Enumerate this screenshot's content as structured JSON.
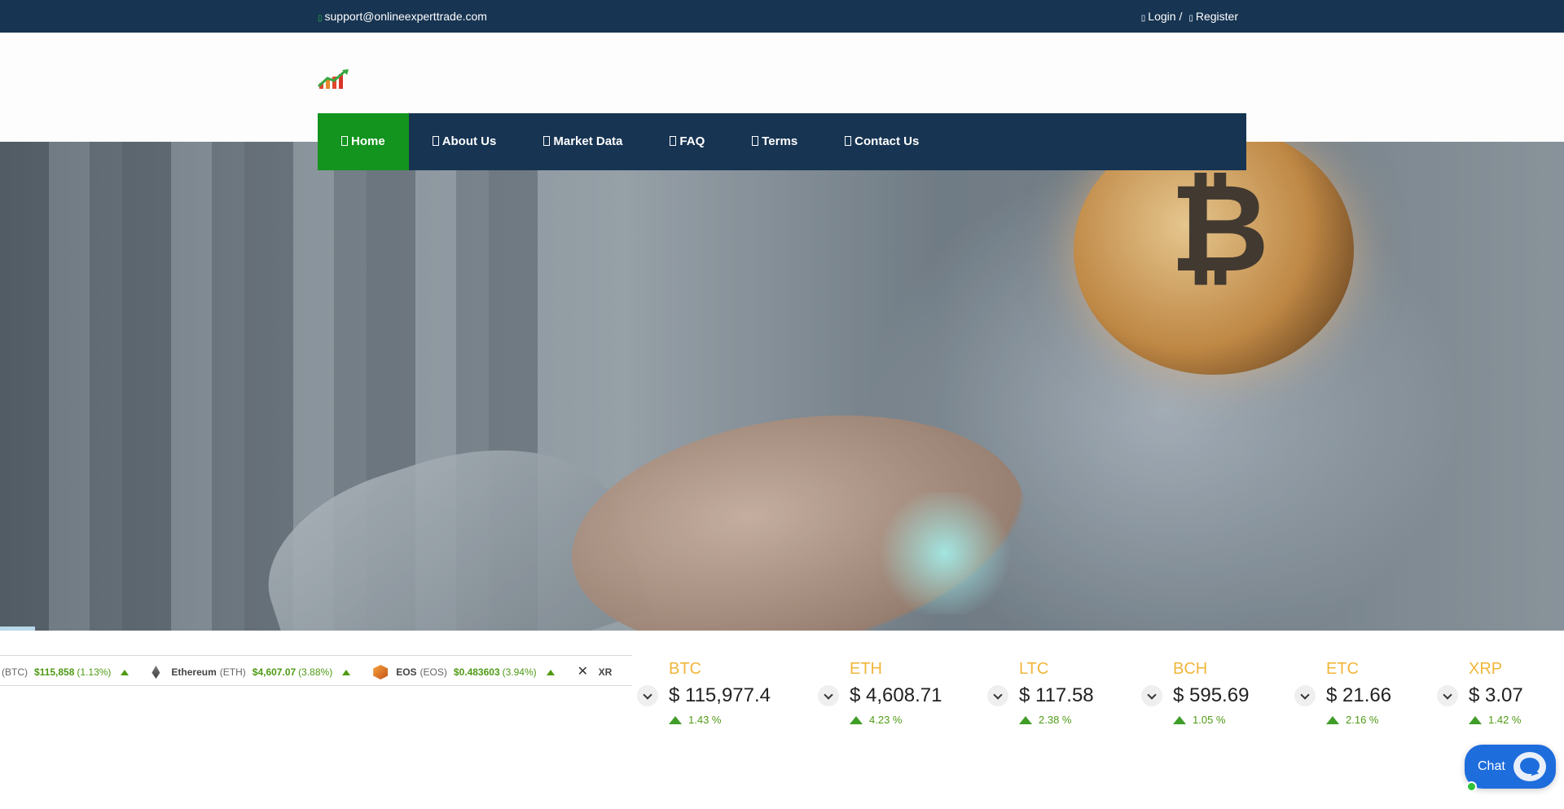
{
  "topbar": {
    "email": "support@onlineexperttrade.com",
    "login": "Login /",
    "register": "Register"
  },
  "nav": {
    "items": [
      {
        "label": "Home",
        "active": true
      },
      {
        "label": "About Us"
      },
      {
        "label": "Market Data"
      },
      {
        "label": "FAQ"
      },
      {
        "label": "Terms"
      },
      {
        "label": "Contact Us"
      }
    ]
  },
  "ticker": {
    "items": [
      {
        "name": "",
        "symbol": "(BTC)",
        "price": "$115,858",
        "change": "(1.13%)"
      },
      {
        "name": "Ethereum",
        "symbol": "(ETH)",
        "price": "$4,607.07",
        "change": "(3.88%)"
      },
      {
        "name": "EOS",
        "symbol": "(EOS)",
        "price": "$0.483603",
        "change": "(3.94%)"
      },
      {
        "name": "XR",
        "symbol": "",
        "price": "",
        "change": ""
      }
    ]
  },
  "prices": [
    {
      "symbol": "BTC",
      "value": "$ 115,977.4",
      "change": "1.43 %"
    },
    {
      "symbol": "ETH",
      "value": "$ 4,608.71",
      "change": "4.23 %"
    },
    {
      "symbol": "LTC",
      "value": "$ 117.58",
      "change": "2.38 %"
    },
    {
      "symbol": "BCH",
      "value": "$ 595.69",
      "change": "1.05 %"
    },
    {
      "symbol": "ETC",
      "value": "$ 21.66",
      "change": "2.16 %"
    },
    {
      "symbol": "XRP",
      "value": "$ 3.07",
      "change": "1.42 %"
    }
  ],
  "chat": {
    "label": "Chat"
  },
  "colors": {
    "navy": "#173452",
    "active_green": "#13941e",
    "price_green": "#4f9a14",
    "symbol_gold": "#f0b63b",
    "chat_blue": "#1e6ddc"
  },
  "icons": [
    "envelope-icon",
    "user-icon",
    "user-plus-icon",
    "home-icon",
    "info-icon",
    "chart-icon",
    "question-icon",
    "file-icon",
    "phone-icon",
    "chevron-down-icon",
    "up-arrow-icon",
    "chat-bubble-icon"
  ]
}
